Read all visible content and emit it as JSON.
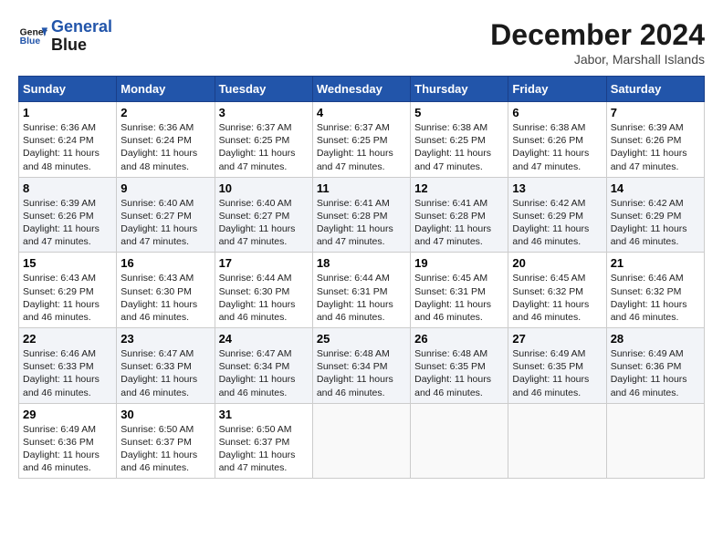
{
  "header": {
    "logo_line1": "General",
    "logo_line2": "Blue",
    "month_title": "December 2024",
    "location": "Jabor, Marshall Islands"
  },
  "days_of_week": [
    "Sunday",
    "Monday",
    "Tuesday",
    "Wednesday",
    "Thursday",
    "Friday",
    "Saturday"
  ],
  "weeks": [
    [
      {
        "day": 1,
        "sunrise": "6:36 AM",
        "sunset": "6:24 PM",
        "daylight": "11 hours and 48 minutes."
      },
      {
        "day": 2,
        "sunrise": "6:36 AM",
        "sunset": "6:24 PM",
        "daylight": "11 hours and 48 minutes."
      },
      {
        "day": 3,
        "sunrise": "6:37 AM",
        "sunset": "6:25 PM",
        "daylight": "11 hours and 47 minutes."
      },
      {
        "day": 4,
        "sunrise": "6:37 AM",
        "sunset": "6:25 PM",
        "daylight": "11 hours and 47 minutes."
      },
      {
        "day": 5,
        "sunrise": "6:38 AM",
        "sunset": "6:25 PM",
        "daylight": "11 hours and 47 minutes."
      },
      {
        "day": 6,
        "sunrise": "6:38 AM",
        "sunset": "6:26 PM",
        "daylight": "11 hours and 47 minutes."
      },
      {
        "day": 7,
        "sunrise": "6:39 AM",
        "sunset": "6:26 PM",
        "daylight": "11 hours and 47 minutes."
      }
    ],
    [
      {
        "day": 8,
        "sunrise": "6:39 AM",
        "sunset": "6:26 PM",
        "daylight": "11 hours and 47 minutes."
      },
      {
        "day": 9,
        "sunrise": "6:40 AM",
        "sunset": "6:27 PM",
        "daylight": "11 hours and 47 minutes."
      },
      {
        "day": 10,
        "sunrise": "6:40 AM",
        "sunset": "6:27 PM",
        "daylight": "11 hours and 47 minutes."
      },
      {
        "day": 11,
        "sunrise": "6:41 AM",
        "sunset": "6:28 PM",
        "daylight": "11 hours and 47 minutes."
      },
      {
        "day": 12,
        "sunrise": "6:41 AM",
        "sunset": "6:28 PM",
        "daylight": "11 hours and 47 minutes."
      },
      {
        "day": 13,
        "sunrise": "6:42 AM",
        "sunset": "6:29 PM",
        "daylight": "11 hours and 46 minutes."
      },
      {
        "day": 14,
        "sunrise": "6:42 AM",
        "sunset": "6:29 PM",
        "daylight": "11 hours and 46 minutes."
      }
    ],
    [
      {
        "day": 15,
        "sunrise": "6:43 AM",
        "sunset": "6:29 PM",
        "daylight": "11 hours and 46 minutes."
      },
      {
        "day": 16,
        "sunrise": "6:43 AM",
        "sunset": "6:30 PM",
        "daylight": "11 hours and 46 minutes."
      },
      {
        "day": 17,
        "sunrise": "6:44 AM",
        "sunset": "6:30 PM",
        "daylight": "11 hours and 46 minutes."
      },
      {
        "day": 18,
        "sunrise": "6:44 AM",
        "sunset": "6:31 PM",
        "daylight": "11 hours and 46 minutes."
      },
      {
        "day": 19,
        "sunrise": "6:45 AM",
        "sunset": "6:31 PM",
        "daylight": "11 hours and 46 minutes."
      },
      {
        "day": 20,
        "sunrise": "6:45 AM",
        "sunset": "6:32 PM",
        "daylight": "11 hours and 46 minutes."
      },
      {
        "day": 21,
        "sunrise": "6:46 AM",
        "sunset": "6:32 PM",
        "daylight": "11 hours and 46 minutes."
      }
    ],
    [
      {
        "day": 22,
        "sunrise": "6:46 AM",
        "sunset": "6:33 PM",
        "daylight": "11 hours and 46 minutes."
      },
      {
        "day": 23,
        "sunrise": "6:47 AM",
        "sunset": "6:33 PM",
        "daylight": "11 hours and 46 minutes."
      },
      {
        "day": 24,
        "sunrise": "6:47 AM",
        "sunset": "6:34 PM",
        "daylight": "11 hours and 46 minutes."
      },
      {
        "day": 25,
        "sunrise": "6:48 AM",
        "sunset": "6:34 PM",
        "daylight": "11 hours and 46 minutes."
      },
      {
        "day": 26,
        "sunrise": "6:48 AM",
        "sunset": "6:35 PM",
        "daylight": "11 hours and 46 minutes."
      },
      {
        "day": 27,
        "sunrise": "6:49 AM",
        "sunset": "6:35 PM",
        "daylight": "11 hours and 46 minutes."
      },
      {
        "day": 28,
        "sunrise": "6:49 AM",
        "sunset": "6:36 PM",
        "daylight": "11 hours and 46 minutes."
      }
    ],
    [
      {
        "day": 29,
        "sunrise": "6:49 AM",
        "sunset": "6:36 PM",
        "daylight": "11 hours and 46 minutes."
      },
      {
        "day": 30,
        "sunrise": "6:50 AM",
        "sunset": "6:37 PM",
        "daylight": "11 hours and 46 minutes."
      },
      {
        "day": 31,
        "sunrise": "6:50 AM",
        "sunset": "6:37 PM",
        "daylight": "11 hours and 47 minutes."
      },
      null,
      null,
      null,
      null
    ]
  ]
}
